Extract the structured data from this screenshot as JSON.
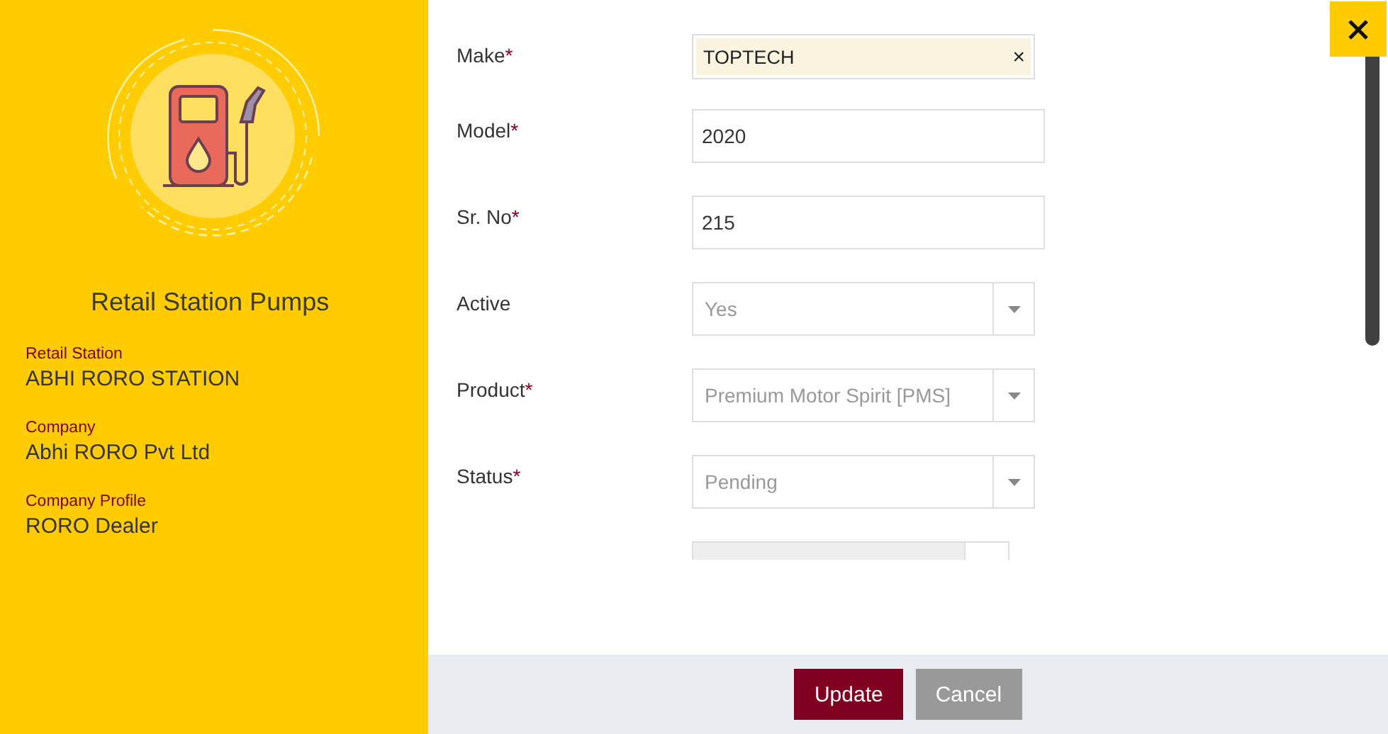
{
  "sidebar": {
    "title": "Retail Station Pumps",
    "details": [
      {
        "label": "Retail Station",
        "value": "ABHI RORO STATION"
      },
      {
        "label": "Company",
        "value": "Abhi RORO Pvt Ltd"
      },
      {
        "label": "Company Profile",
        "value": "RORO Dealer"
      }
    ]
  },
  "form": {
    "fields": [
      {
        "kind": "tag",
        "label": "Make",
        "mark": "*",
        "value": "TOPTECH",
        "clear": "×",
        "disabled": false
      },
      {
        "kind": "text",
        "label": "Model",
        "mark": "*",
        "value": "2020",
        "disabled": false
      },
      {
        "kind": "text",
        "label": "Sr. No",
        "mark": "*",
        "value": "215",
        "disabled": false
      },
      {
        "kind": "select",
        "label": "Active",
        "value": "Yes",
        "disabled": true
      },
      {
        "kind": "select",
        "label": "Product",
        "mark": "*",
        "value": "Premium Motor Spirit [PMS]",
        "disabled": true
      },
      {
        "kind": "select",
        "label": "Status",
        "mark": "*",
        "value": "Pending",
        "disabled": true
      },
      {
        "kind": "date",
        "disabled": true
      }
    ]
  },
  "buttons": [
    {
      "label": "Update",
      "kind": "primary"
    },
    {
      "label": "Cancel",
      "kind": "secondary"
    }
  ]
}
